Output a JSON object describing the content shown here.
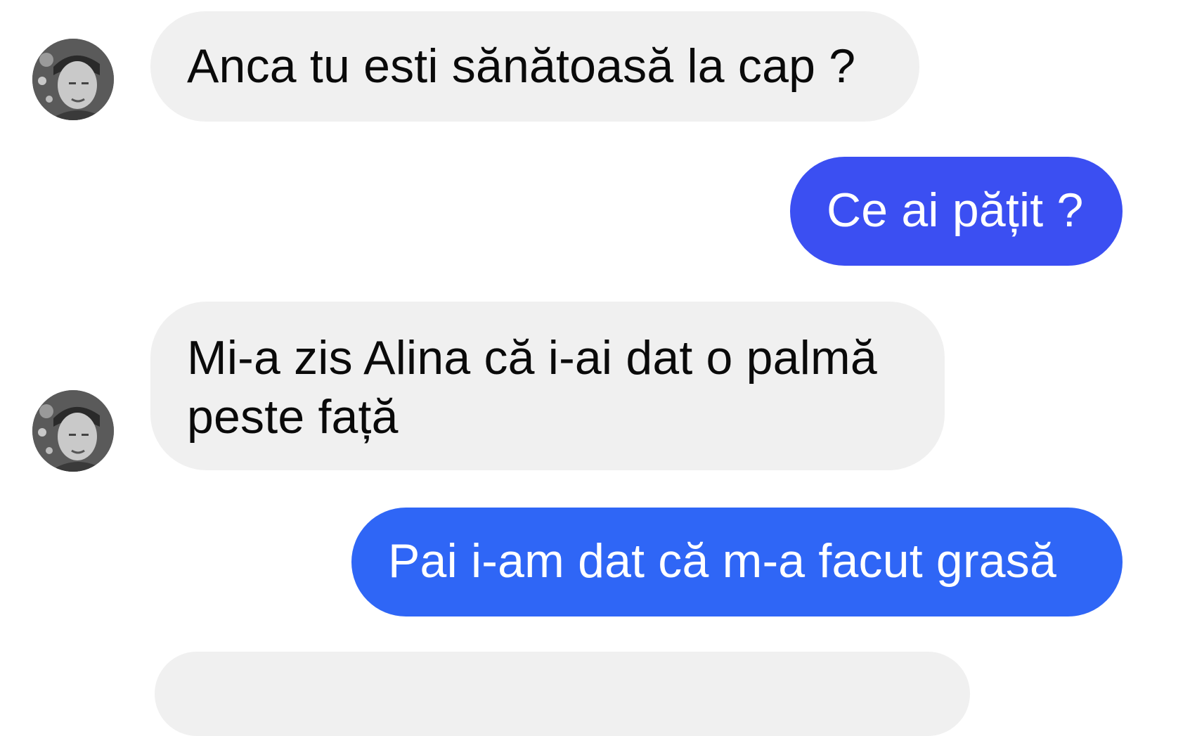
{
  "conversation": {
    "messages": [
      {
        "sender": "contact",
        "text": "Anca tu esti sănătoasă la cap ?"
      },
      {
        "sender": "me",
        "text": "Ce ai pățit ?"
      },
      {
        "sender": "contact",
        "text": "Mi-a zis Alina că i-ai dat o palmă peste față"
      },
      {
        "sender": "me",
        "text": "Pai i-am dat că m-a facut grasă"
      },
      {
        "sender": "contact",
        "text": ""
      }
    ]
  },
  "colors": {
    "incoming_bubble": "#f0f0f0",
    "outgoing_bubble_1": "#3b4ff2",
    "outgoing_bubble_2": "#2f66f6",
    "background": "#ffffff"
  },
  "icons": {
    "avatar": "contact-avatar-photo"
  }
}
